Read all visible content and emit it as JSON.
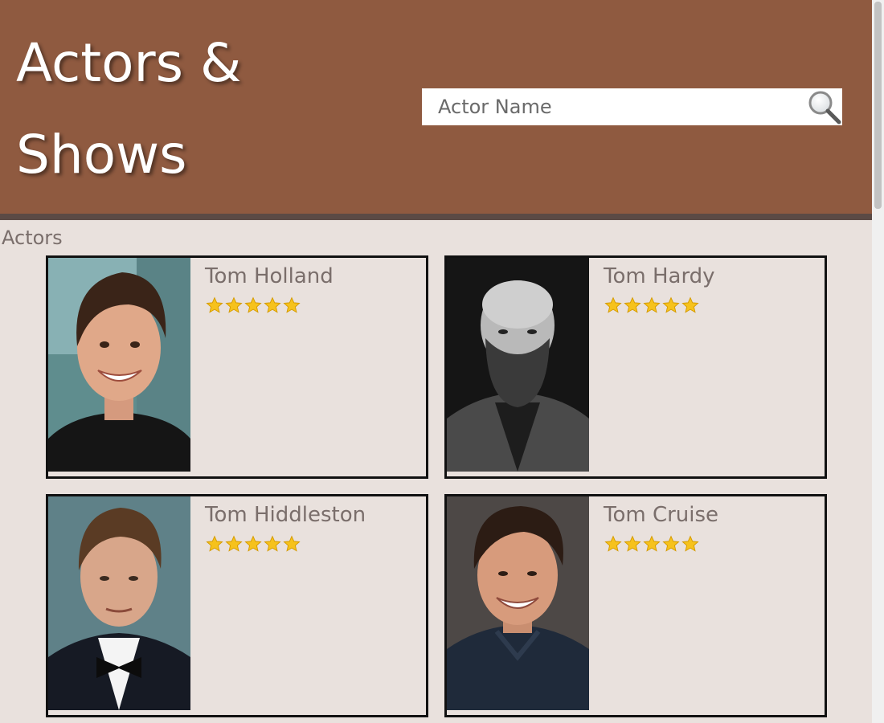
{
  "site": {
    "title": "Actors & Shows"
  },
  "search": {
    "placeholder": "Actor Name",
    "value": ""
  },
  "section": {
    "label": "Actors"
  },
  "actors": [
    {
      "name": "Tom Holland",
      "rating": 5,
      "max_rating": 5
    },
    {
      "name": "Tom Hardy",
      "rating": 5,
      "max_rating": 5
    },
    {
      "name": "Tom Hiddleston",
      "rating": 5,
      "max_rating": 5
    },
    {
      "name": "Tom Cruise",
      "rating": 5,
      "max_rating": 5
    }
  ],
  "colors": {
    "header": "#8f5a40",
    "header_strip": "#5b4a45",
    "background": "#e9e1dd",
    "text_muted": "#7a6e6b",
    "card_border": "#111111",
    "star_fill": "#f6c21c"
  },
  "icons": {
    "search": "magnifier-icon",
    "rating": "star-icon"
  }
}
